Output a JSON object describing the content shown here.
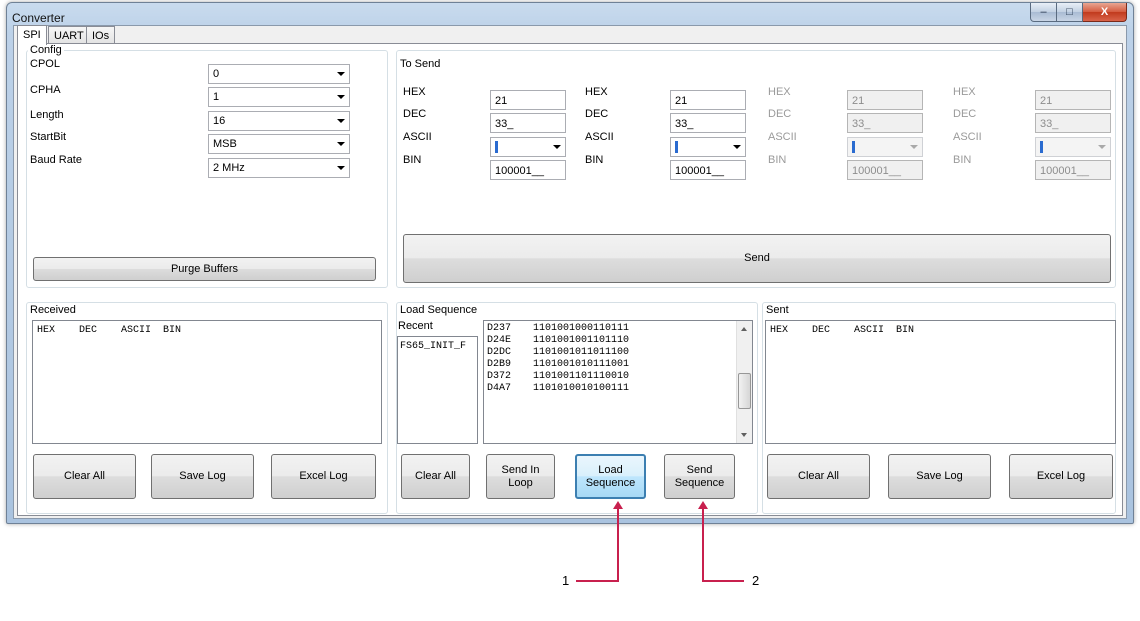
{
  "window": {
    "title": "Converter",
    "minimize_glyph": "–",
    "maximize_glyph": "□",
    "close_glyph": "X"
  },
  "tabs": [
    {
      "label": "SPI"
    },
    {
      "label": "UART"
    },
    {
      "label": "IOs"
    }
  ],
  "config": {
    "title": "Config",
    "rows": [
      {
        "label": "CPOL",
        "value": "0"
      },
      {
        "label": "CPHA",
        "value": "1"
      },
      {
        "label": "Length",
        "value": "16"
      },
      {
        "label": "StartBit",
        "value": "MSB"
      },
      {
        "label": "Baud Rate",
        "value": "2 MHz"
      }
    ],
    "purge_label": "Purge Buffers"
  },
  "to_send": {
    "title": "To Send",
    "labels": {
      "hex": "HEX",
      "dec": "DEC",
      "ascii": "ASCII",
      "bin": "BIN"
    },
    "columns": [
      {
        "hex": "21",
        "dec": "33_",
        "bin": "100001__",
        "enabled": true
      },
      {
        "hex": "21",
        "dec": "33_",
        "bin": "100001__",
        "enabled": true
      },
      {
        "hex": "21",
        "dec": "33_",
        "bin": "100001__",
        "enabled": false
      },
      {
        "hex": "21",
        "dec": "33_",
        "bin": "100001__",
        "enabled": false
      }
    ],
    "send_label": "Send"
  },
  "received": {
    "title": "Received",
    "header": "HEX    DEC    ASCII  BIN",
    "buttons": {
      "clear": "Clear All",
      "save": "Save Log",
      "excel": "Excel Log"
    }
  },
  "load_sequence": {
    "title": "Load Sequence",
    "recent_label": "Recent",
    "recent_items": [
      "FS65_INIT_F"
    ],
    "sequence": [
      {
        "hex": "D237",
        "bin": "1101001000110111"
      },
      {
        "hex": "D24E",
        "bin": "1101001001101110"
      },
      {
        "hex": "D2DC",
        "bin": "1101001011011100"
      },
      {
        "hex": "D2B9",
        "bin": "1101001010111001"
      },
      {
        "hex": "D372",
        "bin": "1101001101110010"
      },
      {
        "hex": "D4A7",
        "bin": "1101010010100111"
      }
    ],
    "buttons": {
      "clear": "Clear All",
      "loop": "Send In Loop",
      "load": "Load Sequence",
      "send": "Send Sequence"
    }
  },
  "sent": {
    "title": "Sent",
    "header": "HEX    DEC    ASCII  BIN",
    "buttons": {
      "clear": "Clear All",
      "save": "Save Log",
      "excel": "Excel Log"
    }
  },
  "callouts": [
    {
      "number": "1"
    },
    {
      "number": "2"
    }
  ],
  "colors": {
    "callout": "#c8204e",
    "focus_border": "#3c7fb1"
  }
}
